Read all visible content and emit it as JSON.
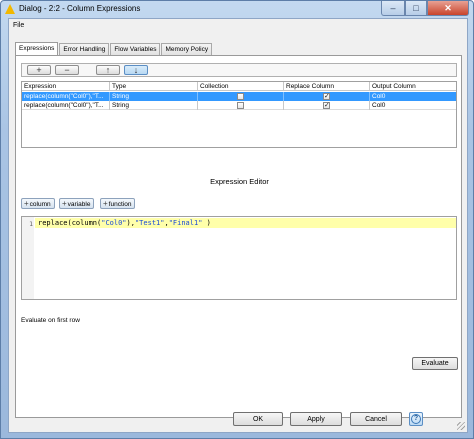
{
  "window": {
    "title": "Dialog - 2:2 - Column Expressions",
    "icon": "warning-triangle-icon",
    "min_label": "–",
    "max_label": "□",
    "close_label": "✕"
  },
  "menu": {
    "file": "File"
  },
  "tabs": [
    "Expressions",
    "Error Handling",
    "Flow Variables",
    "Memory Policy"
  ],
  "toolbar": {
    "add_label": "+",
    "remove_label": "−",
    "up_label": "↑",
    "down_label": "↓"
  },
  "table": {
    "headers": [
      "Expression",
      "Type",
      "Collection",
      "Replace Column",
      "Output Column"
    ],
    "rows": [
      {
        "expression": "replace(column(\"Col0\"),\"T...",
        "type": "String",
        "collection": false,
        "replace": true,
        "output": "Col0",
        "selected": true
      },
      {
        "expression": "replace(column(\"Col0\"),\"T...",
        "type": "String",
        "collection": false,
        "replace": true,
        "output": "Col0",
        "selected": false
      }
    ]
  },
  "editor": {
    "title": "Expression Editor",
    "insert_buttons": {
      "column": "column",
      "variable": "variable",
      "function": "function"
    },
    "line_number": "1",
    "code": {
      "fn1": "replace(",
      "fn2": "column(",
      "arg_col": "\"Col0\"",
      "mid": "),",
      "arg_find": "\"Test1\"",
      "comma": ",",
      "arg_repl": "\"Final1\"",
      "end": " )"
    }
  },
  "evaluate": {
    "label": "Evaluate on first row",
    "button": "Evaluate"
  },
  "footer": {
    "ok": "OK",
    "apply": "Apply",
    "cancel": "Cancel",
    "help": "?"
  },
  "colors": {
    "selection": "#3399ff",
    "code_line_highlight": "#ffffaa",
    "string_literal": "#1a4bd6"
  }
}
